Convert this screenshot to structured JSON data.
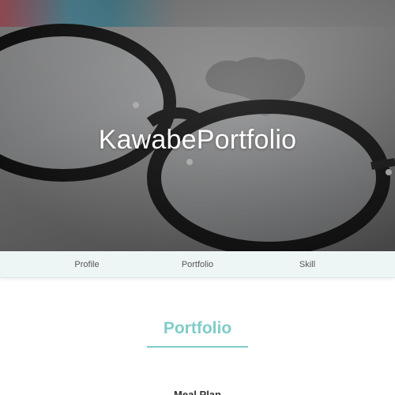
{
  "hero": {
    "title": "KawabePortfolio"
  },
  "nav": {
    "items": [
      {
        "label": "Profile"
      },
      {
        "label": "Portfolio"
      },
      {
        "label": "Skill"
      }
    ]
  },
  "portfolio": {
    "heading": "Portfolio",
    "first_work_title": "Meal Plan"
  },
  "colors": {
    "accent": "#7fcdc8",
    "nav_background": "#eef6f5",
    "hero_text": "#ffffff"
  }
}
